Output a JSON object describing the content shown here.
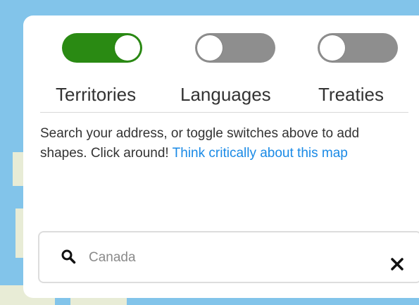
{
  "toggles": [
    {
      "label": "Territories",
      "state": "on"
    },
    {
      "label": "Languages",
      "state": "off"
    },
    {
      "label": "Treaties",
      "state": "off"
    }
  ],
  "description": {
    "text": "Search your address, or toggle switches above to add shapes. Click around! ",
    "link_text": "Think critically about this map"
  },
  "search": {
    "placeholder": "Canada",
    "value": ""
  },
  "colors": {
    "toggle_on": "#2a8a13",
    "toggle_off": "#8e8e8e",
    "link": "#1a8ae6",
    "water": "#82c4ea",
    "land": "#e8ecd6"
  },
  "icons": {
    "search": "magnifying-glass",
    "close": "x-mark"
  }
}
